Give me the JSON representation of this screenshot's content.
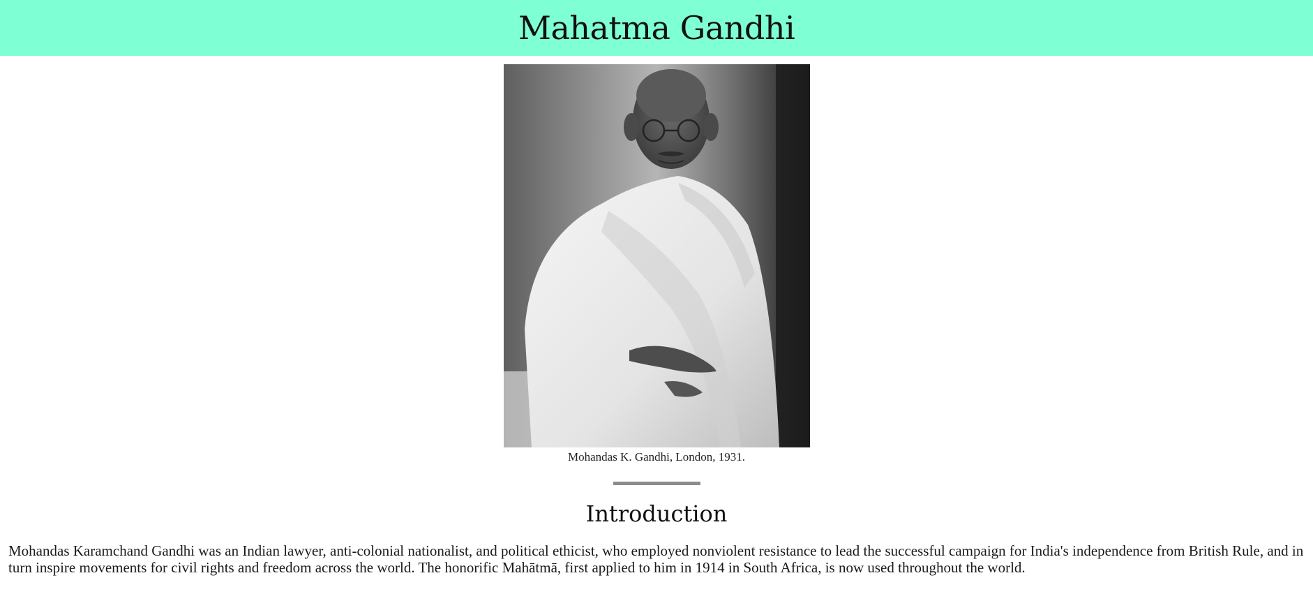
{
  "header": {
    "title": "Mahatma Gandhi"
  },
  "figure": {
    "image_label": "Portrait photograph of Mohandas K. Gandhi",
    "caption": "Mohandas K. Gandhi, London, 1931."
  },
  "section": {
    "title": "Introduction",
    "body": "Mohandas Karamchand Gandhi was an Indian lawyer, anti-colonial nationalist, and political ethicist, who employed nonviolent resistance to lead the successful campaign for India's independence from British Rule, and in turn inspire movements for civil rights and freedom across the world. The honorific Mahātmā, first applied to him in 1914 in South Africa, is now used throughout the world."
  },
  "colors": {
    "header_bg": "#7fffd4",
    "divider": "#8c8c8c"
  }
}
